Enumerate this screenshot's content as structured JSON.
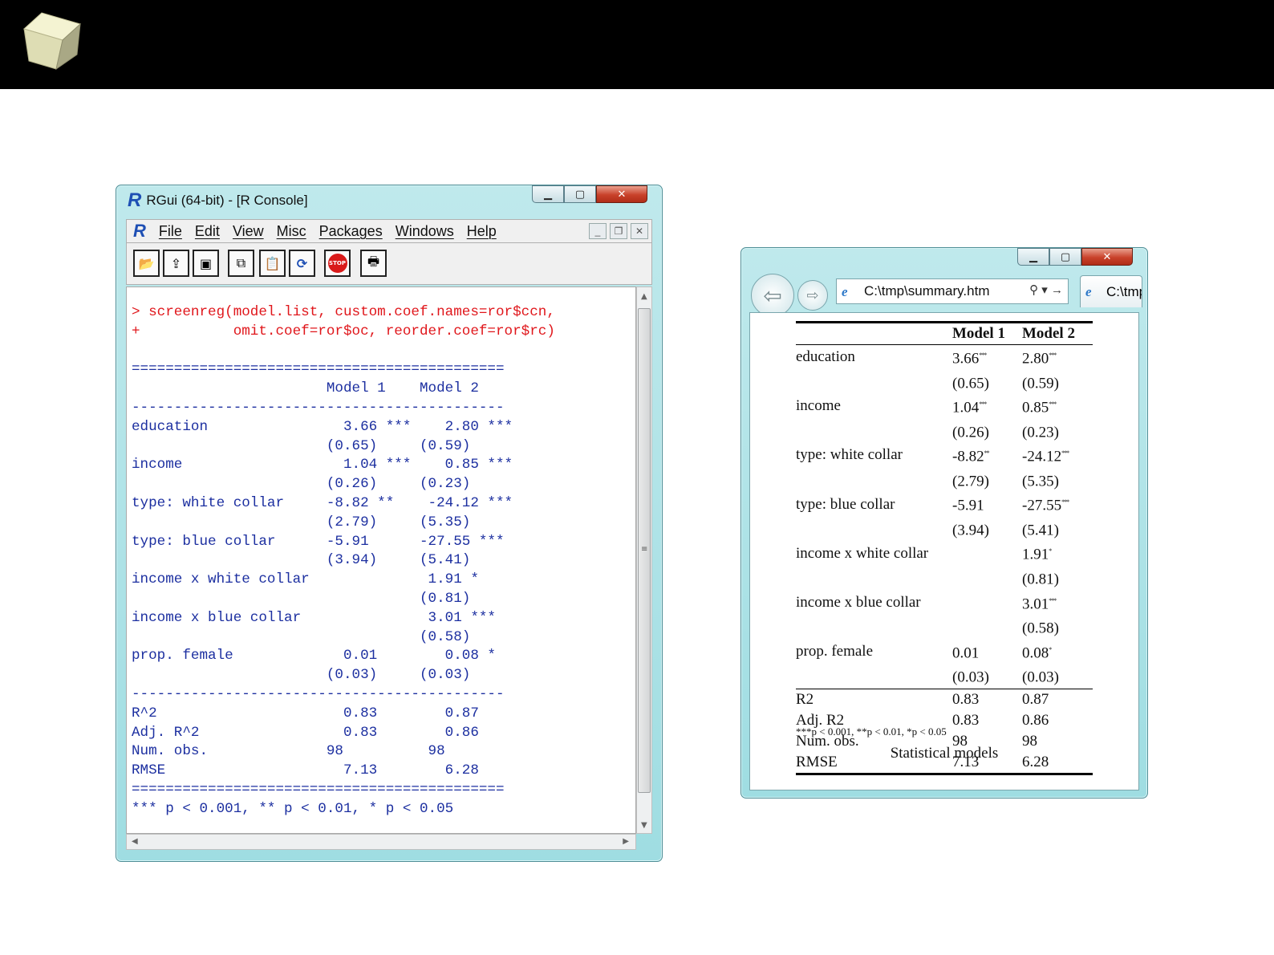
{
  "rgui": {
    "title": "RGui (64-bit) - [R Console]",
    "menu": [
      "File",
      "Edit",
      "View",
      "Misc",
      "Packages",
      "Windows",
      "Help"
    ],
    "toolbar_icons": [
      "open-script-icon",
      "load-workspace-icon",
      "save-icon",
      "copy-icon",
      "paste-icon",
      "refresh-icon",
      "stop-icon",
      "print-icon"
    ],
    "stop_label": "STOP",
    "console_lines": [
      {
        "text": "> screenreg(model.list, custom.coef.names=ror$ccn,",
        "type": "cmd"
      },
      {
        "text": "+           omit.coef=ror$oc, reorder.coef=ror$rc)",
        "type": "cmd"
      },
      {
        "text": "",
        "type": "out"
      },
      {
        "text": "============================================",
        "type": "out"
      },
      {
        "text": "                       Model 1    Model 2",
        "type": "out"
      },
      {
        "text": "--------------------------------------------",
        "type": "out"
      },
      {
        "text": "education                3.66 ***    2.80 ***",
        "type": "out"
      },
      {
        "text": "                       (0.65)     (0.59)",
        "type": "out"
      },
      {
        "text": "income                   1.04 ***    0.85 ***",
        "type": "out"
      },
      {
        "text": "                       (0.26)     (0.23)",
        "type": "out"
      },
      {
        "text": "type: white collar     -8.82 **    -24.12 ***",
        "type": "out"
      },
      {
        "text": "                       (2.79)     (5.35)",
        "type": "out"
      },
      {
        "text": "type: blue collar      -5.91      -27.55 ***",
        "type": "out"
      },
      {
        "text": "                       (3.94)     (5.41)",
        "type": "out"
      },
      {
        "text": "income x white collar              1.91 *",
        "type": "out"
      },
      {
        "text": "                                  (0.81)",
        "type": "out"
      },
      {
        "text": "income x blue collar               3.01 ***",
        "type": "out"
      },
      {
        "text": "                                  (0.58)",
        "type": "out"
      },
      {
        "text": "prop. female             0.01        0.08 *",
        "type": "out"
      },
      {
        "text": "                       (0.03)     (0.03)",
        "type": "out"
      },
      {
        "text": "--------------------------------------------",
        "type": "out"
      },
      {
        "text": "R^2                      0.83        0.87",
        "type": "out"
      },
      {
        "text": "Adj. R^2                 0.83        0.86",
        "type": "out"
      },
      {
        "text": "Num. obs.              98          98",
        "type": "out"
      },
      {
        "text": "RMSE                     7.13        6.28",
        "type": "out"
      },
      {
        "text": "============================================",
        "type": "out"
      },
      {
        "text": "*** p < 0.001, ** p < 0.01, * p < 0.05",
        "type": "out"
      }
    ]
  },
  "browser": {
    "address": "C:\\tmp\\summary.htm",
    "tab_label": "C:\\tmp",
    "table": {
      "headers": [
        "",
        "Model 1",
        "Model 2"
      ],
      "rows": [
        [
          "education",
          "3.66",
          "***",
          "2.80",
          "***"
        ],
        [
          "",
          "(0.65)",
          "",
          "(0.59)",
          ""
        ],
        [
          "income",
          "1.04",
          "***",
          "0.85",
          "***"
        ],
        [
          "",
          "(0.26)",
          "",
          "(0.23)",
          ""
        ],
        [
          "type: white collar",
          "-8.82",
          "**",
          "-24.12",
          "***"
        ],
        [
          "",
          "(2.79)",
          "",
          "(5.35)",
          ""
        ],
        [
          "type: blue collar",
          "-5.91",
          "",
          "-27.55",
          "***"
        ],
        [
          "",
          "(3.94)",
          "",
          "(5.41)",
          ""
        ],
        [
          "income x white collar",
          "",
          "",
          "1.91",
          "*"
        ],
        [
          "",
          "",
          "",
          "(0.81)",
          ""
        ],
        [
          "income x blue collar",
          "",
          "",
          "3.01",
          "***"
        ],
        [
          "",
          "",
          "",
          "(0.58)",
          ""
        ],
        [
          "prop. female",
          "0.01",
          "",
          "0.08",
          "*"
        ],
        [
          "",
          "(0.03)",
          "",
          "(0.03)",
          ""
        ]
      ],
      "gof": [
        [
          "R2",
          "0.83",
          "0.87"
        ],
        [
          "Adj. R2",
          "0.83",
          "0.86"
        ],
        [
          "Num. obs.",
          "98",
          "98"
        ],
        [
          "RMSE",
          "7.13",
          "6.28"
        ]
      ],
      "note": "***p < 0.001, **p < 0.01, *p < 0.05",
      "caption": "Statistical models"
    }
  }
}
